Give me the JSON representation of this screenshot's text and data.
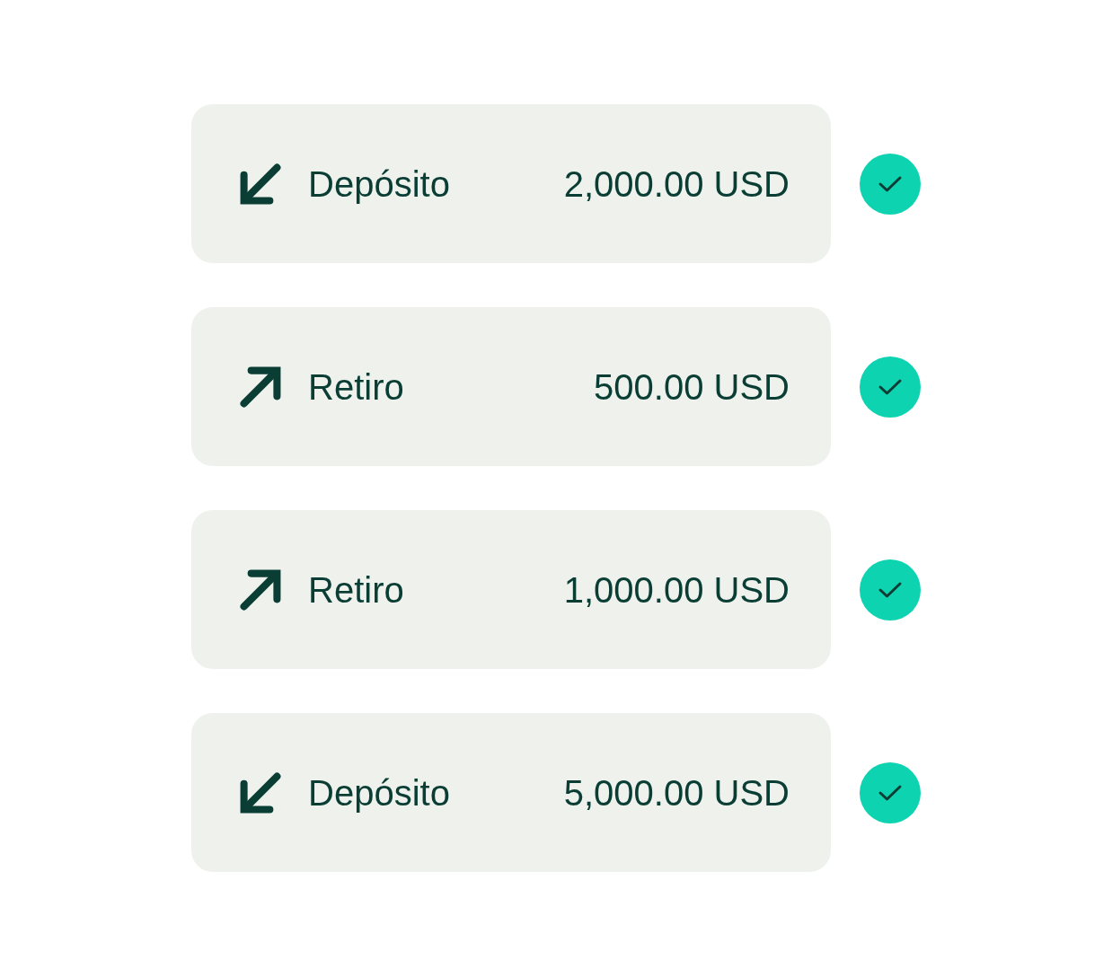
{
  "transactions": [
    {
      "kind": "deposit",
      "label": "Depósito",
      "amount": "2,000.00 USD",
      "completed": true
    },
    {
      "kind": "withdrawal",
      "label": "Retiro",
      "amount": "500.00 USD",
      "completed": true
    },
    {
      "kind": "withdrawal",
      "label": "Retiro",
      "amount": "1,000.00 USD",
      "completed": true
    },
    {
      "kind": "deposit",
      "label": "Depósito",
      "amount": "5,000.00 USD",
      "completed": true
    }
  ]
}
